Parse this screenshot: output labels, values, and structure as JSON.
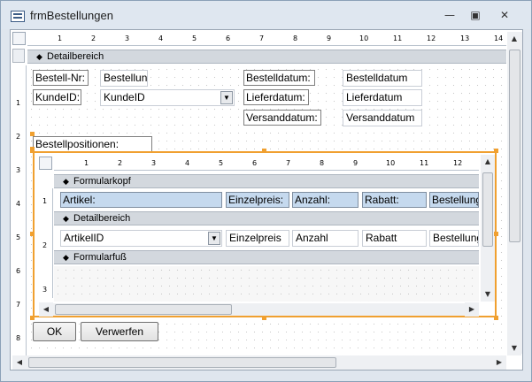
{
  "window": {
    "title": "frmBestellungen"
  },
  "ruler_top": [
    "1",
    "2",
    "3",
    "4",
    "5",
    "6",
    "7",
    "8",
    "9",
    "10",
    "11",
    "12",
    "13",
    "14"
  ],
  "ruler_left": [
    "1",
    "2",
    "3",
    "4",
    "5",
    "6",
    "7",
    "8"
  ],
  "main_detail": {
    "section_label": "Detailbereich",
    "labels": {
      "bestellnr": "Bestell-Nr:",
      "kundeid": "KundeID:",
      "bestelldatum": "Bestelldatum:",
      "lieferdatum": "Lieferdatum:",
      "versanddatum": "Versanddatum:",
      "positionen": "Bestellpositionen:"
    },
    "fields": {
      "bestellnr": "Bestellun",
      "kundeid": "KundeID",
      "bestelldatum": "Bestelldatum",
      "lieferdatum": "Lieferdatum",
      "versanddatum": "Versanddatum"
    }
  },
  "subform": {
    "ruler": [
      "1",
      "2",
      "3",
      "4",
      "5",
      "6",
      "7",
      "8",
      "9",
      "10",
      "11",
      "12"
    ],
    "ruler_left": [
      "1",
      "2",
      "3"
    ],
    "header_section": "Formularkopf",
    "detail_section": "Detailbereich",
    "footer_section": "Formularfuß",
    "header_labels": [
      "Artikel:",
      "Einzelpreis:",
      "Anzahl:",
      "Rabatt:",
      "Bestellung"
    ],
    "detail_fields": [
      "ArtikelID",
      "Einzelpreis",
      "Anzahl",
      "Rabatt",
      "Bestellung"
    ]
  },
  "buttons": {
    "ok": "OK",
    "discard": "Verwerfen"
  },
  "colors": {
    "selection": "#f0a030",
    "section_bar": "#d3d8de",
    "header_label": "#c5d9ee"
  }
}
